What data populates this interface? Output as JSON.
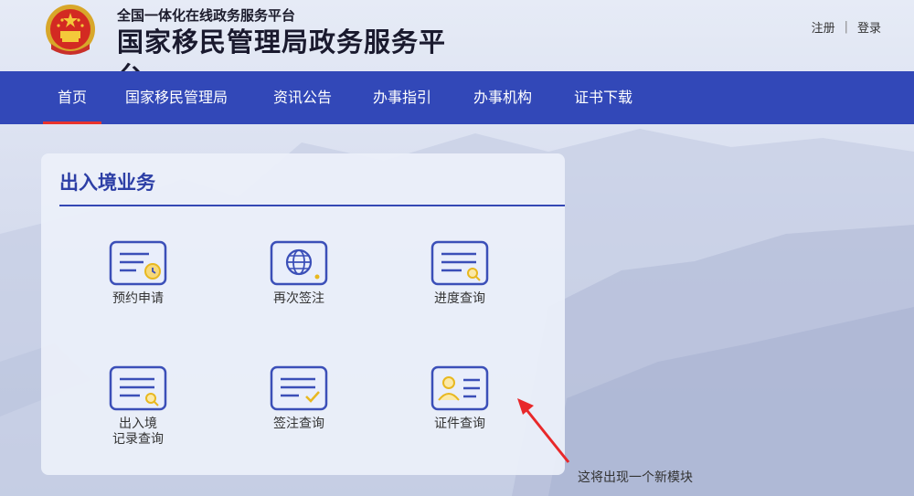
{
  "header": {
    "subtitle": "全国一体化在线政务服务平台",
    "title": "国家移民管理局政务服务平台",
    "register_label": "注册",
    "separator": "|",
    "login_label": "登录"
  },
  "nav": {
    "items": [
      {
        "label": "首页",
        "active": true
      },
      {
        "label": "国家移民管理局"
      },
      {
        "label": "资讯公告"
      },
      {
        "label": "办事指引"
      },
      {
        "label": "办事机构"
      },
      {
        "label": "证书下载"
      }
    ]
  },
  "card": {
    "title": "出入境业务",
    "tiles": [
      {
        "label": "预约申请",
        "icon": "calendar-doc-icon"
      },
      {
        "label": "再次签注",
        "icon": "globe-doc-icon"
      },
      {
        "label": "进度查询",
        "icon": "search-doc-icon"
      },
      {
        "label_line1": "出入境",
        "label_line2": "记录查询",
        "icon": "search-doc-icon"
      },
      {
        "label": "签注查询",
        "icon": "check-doc-icon"
      },
      {
        "label": "证件查询",
        "icon": "id-card-icon"
      }
    ]
  },
  "annotation": {
    "text": "这将出现一个新模块"
  },
  "colors": {
    "nav_bg": "#3248b8",
    "active_underline": "#e8322c",
    "icon_blue": "#3b4fb8",
    "icon_gold": "#e8b820",
    "arrow_red": "#e8282a"
  }
}
